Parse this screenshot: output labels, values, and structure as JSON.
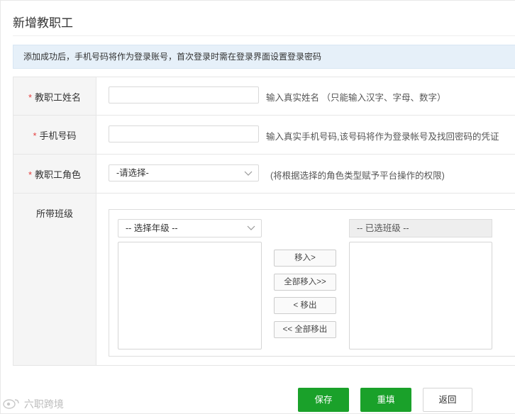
{
  "page": {
    "title": "新增教职工",
    "notice": "添加成功后，手机号码将作为登录账号，首次登录时需在登录界面设置登录密码"
  },
  "form": {
    "name": {
      "required_mark": "*",
      "label": "教职工姓名",
      "value": "",
      "hint": "输入真实姓名 （只能输入汉字、字母、数字）"
    },
    "phone": {
      "required_mark": "*",
      "label": "手机号码",
      "value": "",
      "hint": "输入真实手机号码,该号码将作为登录帐号及找回密码的凭证"
    },
    "role": {
      "required_mark": "*",
      "label": "教职工角色",
      "selected": "-请选择-",
      "hint": "(将根据选择的角色类型赋予平台操作的权限)"
    },
    "classes": {
      "label": "所带班级",
      "grade_selected": "-- 选择年级 --",
      "selected_header": "-- 已选班级 --",
      "buttons": {
        "move_in": "移入>",
        "move_all_in": "全部移入>>",
        "move_out": "< 移出",
        "move_all_out": "<< 全部移出"
      }
    }
  },
  "actions": {
    "save": "保存",
    "reset": "重填",
    "back": "返回"
  },
  "watermark": "六职跨境",
  "colors": {
    "accent_green": "#1aa12a",
    "required_red": "#e53e3e",
    "notice_bg": "#e6f0f9"
  }
}
